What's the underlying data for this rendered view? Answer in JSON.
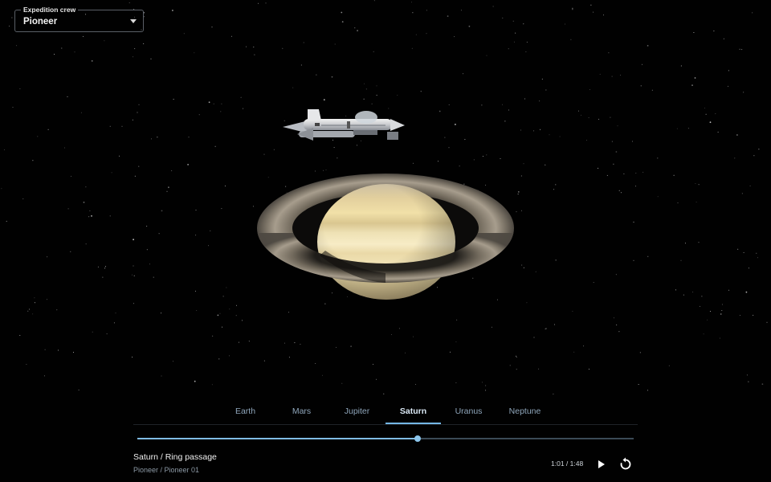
{
  "crew_select": {
    "label": "Expedition crew",
    "value": "Pioneer"
  },
  "tabs": [
    {
      "label": "Earth",
      "active": false
    },
    {
      "label": "Mars",
      "active": false
    },
    {
      "label": "Jupiter",
      "active": false
    },
    {
      "label": "Saturn",
      "active": true
    },
    {
      "label": "Uranus",
      "active": false
    },
    {
      "label": "Neptune",
      "active": false
    }
  ],
  "player": {
    "progress_fraction": 0.565,
    "current_time": "1:01",
    "total_time": "1:48",
    "time_readout": "1:01 / 1:48",
    "track_title": "Saturn / Ring passage",
    "track_subtitle": "Pioneer / Pioneer 01"
  },
  "icons": {
    "select": "chevron-down-icon",
    "play": "play-icon",
    "replay": "replay-icon"
  },
  "colors": {
    "background": "#010101",
    "accent": "#74b7e6",
    "tab_inactive": "#8fa6bb",
    "track": "#3b4a56"
  }
}
